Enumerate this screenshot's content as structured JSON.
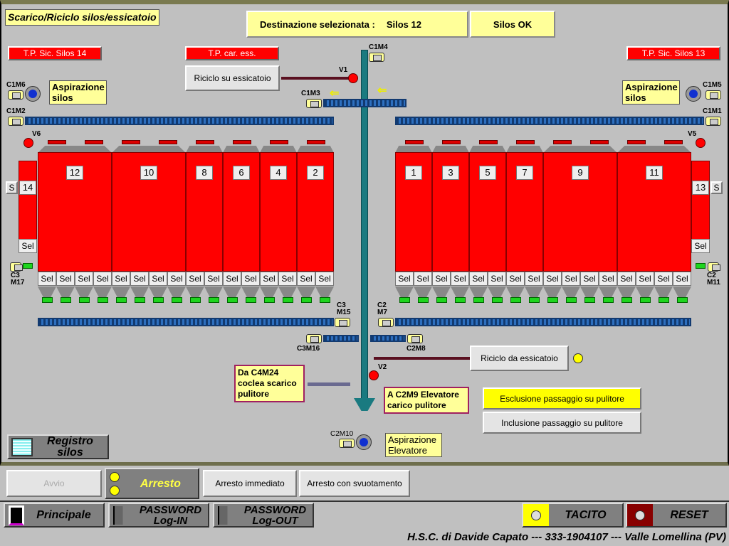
{
  "title": "Scarico/Riciclo silos/essicatoio",
  "destination": {
    "label": "Destinazione selezionata :",
    "value": "Silos 12",
    "status": "Silos OK"
  },
  "alarms": {
    "tp_sic_14": "T.P. Sic. Silos 14",
    "tp_car_ess": "T.P. car. ess.",
    "tp_sic_13": "T.P. Sic. Silos 13"
  },
  "buttons": {
    "riciclo_su": "Riciclo su essicatoio",
    "riciclo_da": "Riciclo da essicatoio",
    "esclusione": "Esclusione passaggio su pulitore",
    "inclusione": "Inclusione passaggio su pulitore",
    "registro": "Registro silos"
  },
  "labels": {
    "asp_silos": "Aspirazione silos",
    "asp_elev": "Aspirazione Elevatore",
    "da_c4m24": "Da C4M24 coclea scarico pulitore",
    "a_c2m9": "A C2M9 Elevatore carico pulitore"
  },
  "motors": {
    "c1m4": "C1M4",
    "c1m6": "C1M6",
    "c1m2": "C1M2",
    "c1m3": "C1M3",
    "c1m5": "C1M5",
    "c1m1": "C1M1",
    "c3m17": "C3 M17",
    "c2m11": "C2 M11",
    "c3m15": "C3 M15",
    "c2m7": "C2 M7",
    "c3m16": "C3M16",
    "c2m8": "C2M8",
    "c2m10": "C2M10"
  },
  "valves": {
    "v1": "V1",
    "v2": "V2",
    "v5": "V5",
    "v6": "V6"
  },
  "silos_left": [
    {
      "label": "12",
      "sels": 4
    },
    {
      "label": "10",
      "sels": 4
    },
    {
      "label": "8",
      "sels": 2
    },
    {
      "label": "6",
      "sels": 2
    },
    {
      "label": "4",
      "sels": 2
    },
    {
      "label": "2",
      "sels": 2
    }
  ],
  "silos_right": [
    {
      "label": "1",
      "sels": 2
    },
    {
      "label": "3",
      "sels": 2
    },
    {
      "label": "5",
      "sels": 2
    },
    {
      "label": "7",
      "sels": 2
    },
    {
      "label": "9",
      "sels": 4
    },
    {
      "label": "11",
      "sels": 4
    }
  ],
  "small_silos": {
    "left": "14",
    "right": "13",
    "s": "S",
    "sel": "Sel"
  },
  "sel_label": "Sel",
  "controls": {
    "avvio": "Avvio",
    "arresto": "Arresto",
    "arresto_immediato": "Arresto immediato",
    "arresto_svuotamento": "Arresto con svuotamento"
  },
  "nav": {
    "principale": "Principale",
    "pw_in": "PASSWORD Log-IN",
    "pw_out": "PASSWORD Log-OUT",
    "tacito": "TACITO",
    "reset": "RESET"
  },
  "footer": "H.S.C. di Davide Capato --- 333-1904107 --- Valle Lomellina (PV)",
  "colors": {
    "silo": "#ff0000",
    "conveyor": "#1f5aa0",
    "label": "#ffff99",
    "elevator": "#1a7a80"
  }
}
